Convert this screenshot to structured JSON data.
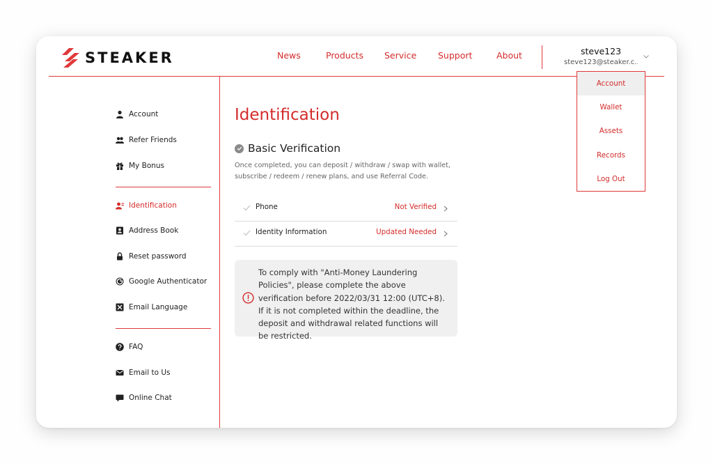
{
  "brand": {
    "name": "STEAKER",
    "accent": "#d42b2b"
  },
  "nav": [
    "News",
    "Products",
    "Service",
    "Support",
    "About"
  ],
  "user": {
    "name": "steve123",
    "email": "steve123@steaker.c..."
  },
  "dropdown": [
    "Account",
    "Wallet",
    "Assets",
    "Records",
    "Log Out"
  ],
  "sidebar": {
    "group1": [
      {
        "label": "Account",
        "icon": "user-icon"
      },
      {
        "label": "Refer Friends",
        "icon": "users-icon"
      },
      {
        "label": "My Bonus",
        "icon": "gift-icon"
      }
    ],
    "group2": [
      {
        "label": "Identification",
        "icon": "id-user-icon",
        "active": true
      },
      {
        "label": "Address Book",
        "icon": "address-book-icon"
      },
      {
        "label": "Reset password",
        "icon": "lock-icon"
      },
      {
        "label": "Google Authenticator",
        "icon": "google-icon"
      },
      {
        "label": "Email Language",
        "icon": "translate-icon"
      }
    ],
    "group3": [
      {
        "label": "FAQ",
        "icon": "question-icon"
      },
      {
        "label": "Email to Us",
        "icon": "mail-icon"
      },
      {
        "label": "Online Chat",
        "icon": "chat-icon"
      }
    ]
  },
  "main": {
    "title": "Identification",
    "section_title": "Basic Verification",
    "section_desc": "Once completed, you can deposit / withdraw / swap with wallet, subscribe / redeem / renew plans, and use Referral Code.",
    "rows": [
      {
        "label": "Phone",
        "status": "Not Verified"
      },
      {
        "label": "Identity Information",
        "status": "Updated Needed"
      }
    ],
    "notice": "To comply with \"Anti-Money Laundering Policies\", please complete the above verification before 2022/03/31 12:00 (UTC+8). If it is not completed within the deadline, the deposit and withdrawal related functions will be restricted."
  }
}
